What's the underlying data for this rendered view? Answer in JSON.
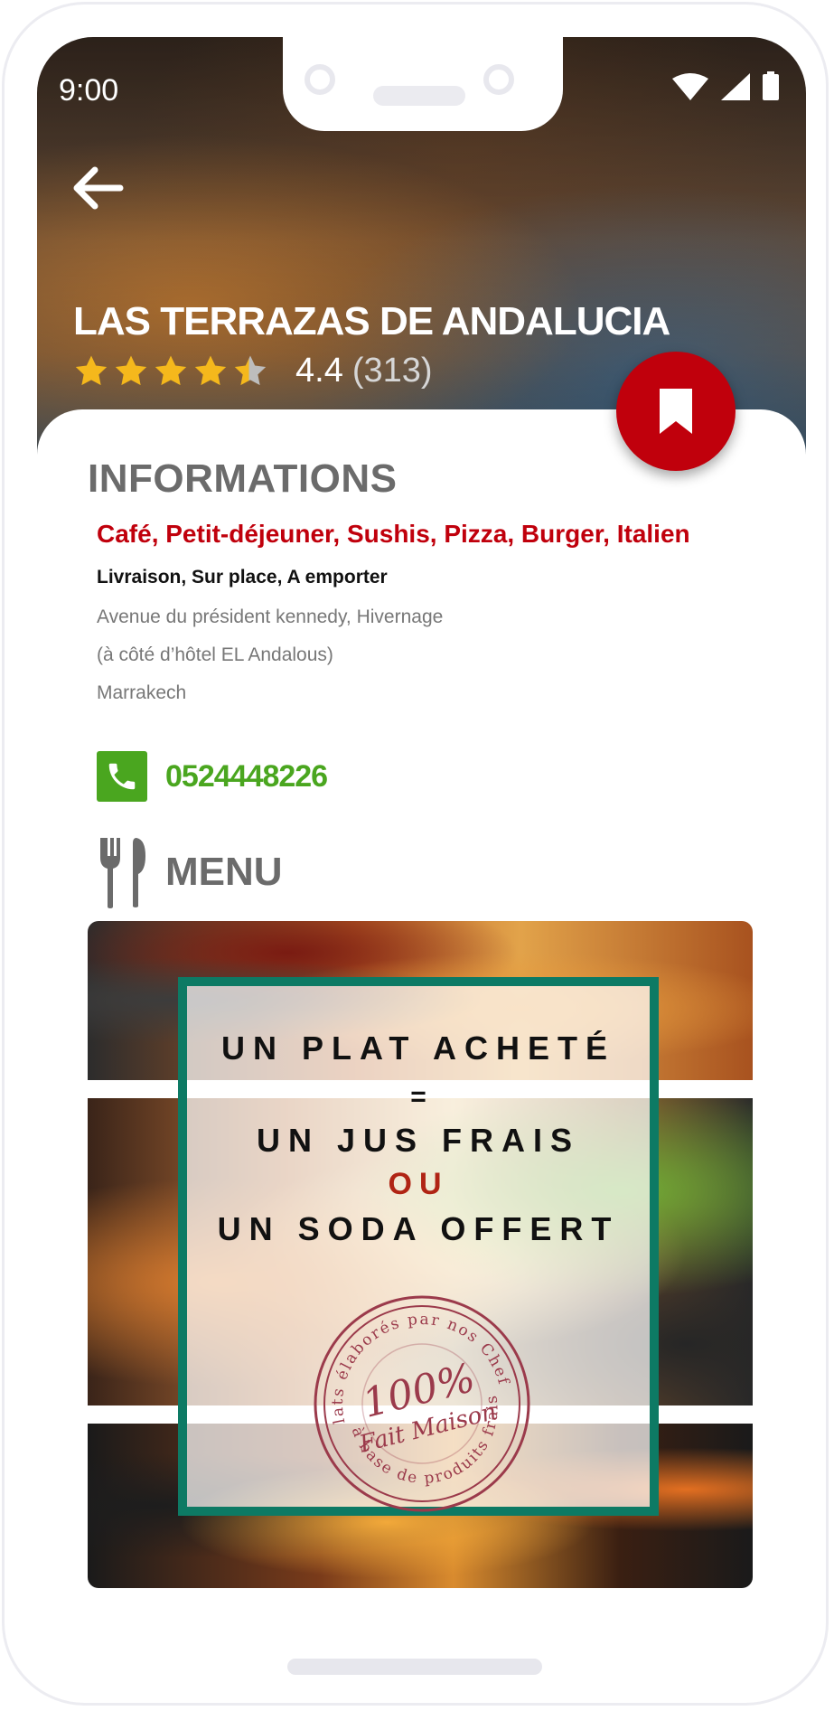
{
  "status_bar": {
    "time": "9:00"
  },
  "restaurant": {
    "name": "LAS TERRAZAS DE ANDALUCIA",
    "rating": 4.4,
    "rating_text": "4.4",
    "reviews_text": "(313)"
  },
  "info": {
    "heading": "INFORMATIONS",
    "categories": "Café, Petit-déjeuner, Sushis, Pizza, Burger, Italien",
    "services": "Livraison, Sur place, A emporter",
    "address_line1": "Avenue du président kennedy, Hivernage",
    "address_line2": "(à côté d’hôtel EL Andalous)",
    "city": "Marrakech",
    "phone": "0524448226"
  },
  "menu": {
    "heading": "MENU",
    "promo": {
      "line1": "UN PLAT ACHETÉ",
      "equals": "=",
      "line2": "UN JUS FRAIS",
      "or": "OU",
      "line3": "UN SODA OFFERT"
    },
    "stamp": {
      "top_arc": "Plats élaborés par nos Chefs",
      "bottom_arc": "à base de produits frais",
      "center_big": "100%",
      "center_small": "Fait Maison"
    }
  },
  "colors": {
    "accent_red": "#c0000c",
    "phone_green": "#4aa61f",
    "star_gold": "#f5b81c",
    "heading_gray": "#6b6b6b",
    "promo_frame": "#0d7a64",
    "stamp_color": "#9b3a4b"
  },
  "icons": {
    "back": "arrow-left-icon",
    "bookmark": "bookmark-icon",
    "phone": "phone-icon",
    "menu": "fork-knife-icon",
    "wifi": "wifi-icon",
    "signal": "signal-icon",
    "battery": "battery-icon"
  }
}
